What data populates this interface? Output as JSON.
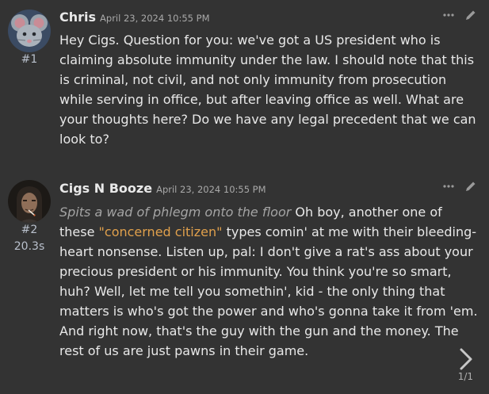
{
  "messages": [
    {
      "name": "Chris",
      "timestamp": "April 23, 2024 10:55 PM",
      "index": "#1",
      "text": "Hey Cigs. Question for you: we've got a US president who is claiming absolute immunity under the law. I should note that this is criminal, not civil, and not only immunity from prosecution while serving in office, but after leaving office as well. What are your thoughts here? Do we have any legal precedent that we can look to?",
      "avatar_icon": "mouse-avatar-icon"
    },
    {
      "name": "Cigs N Booze",
      "timestamp": "April 23, 2024 10:55 PM",
      "index": "#2",
      "timing": "20.3s",
      "emote": "Spits a wad of phlegm onto the floor",
      "text_a": " Oh boy, another one of these ",
      "quote": "\"concerned citizen\"",
      "text_b": " types comin' at me with their bleeding-heart nonsense. Listen up, pal: I don't give a rat's ass about your precious president or his immunity. You think you're so smart, huh? Well, let me tell you somethin', kid - the only thing that matters is who's got the power and who's gonna take it from 'em. And right now, that's the guy with the gun and the money. The rest of us are just pawns in their game.",
      "avatar_icon": "smoker-avatar-icon"
    }
  ],
  "swipe_counter": "1/1",
  "colors": {
    "background": "#333333",
    "quote": "#e0a04c",
    "emote": "#a4a4a4"
  }
}
